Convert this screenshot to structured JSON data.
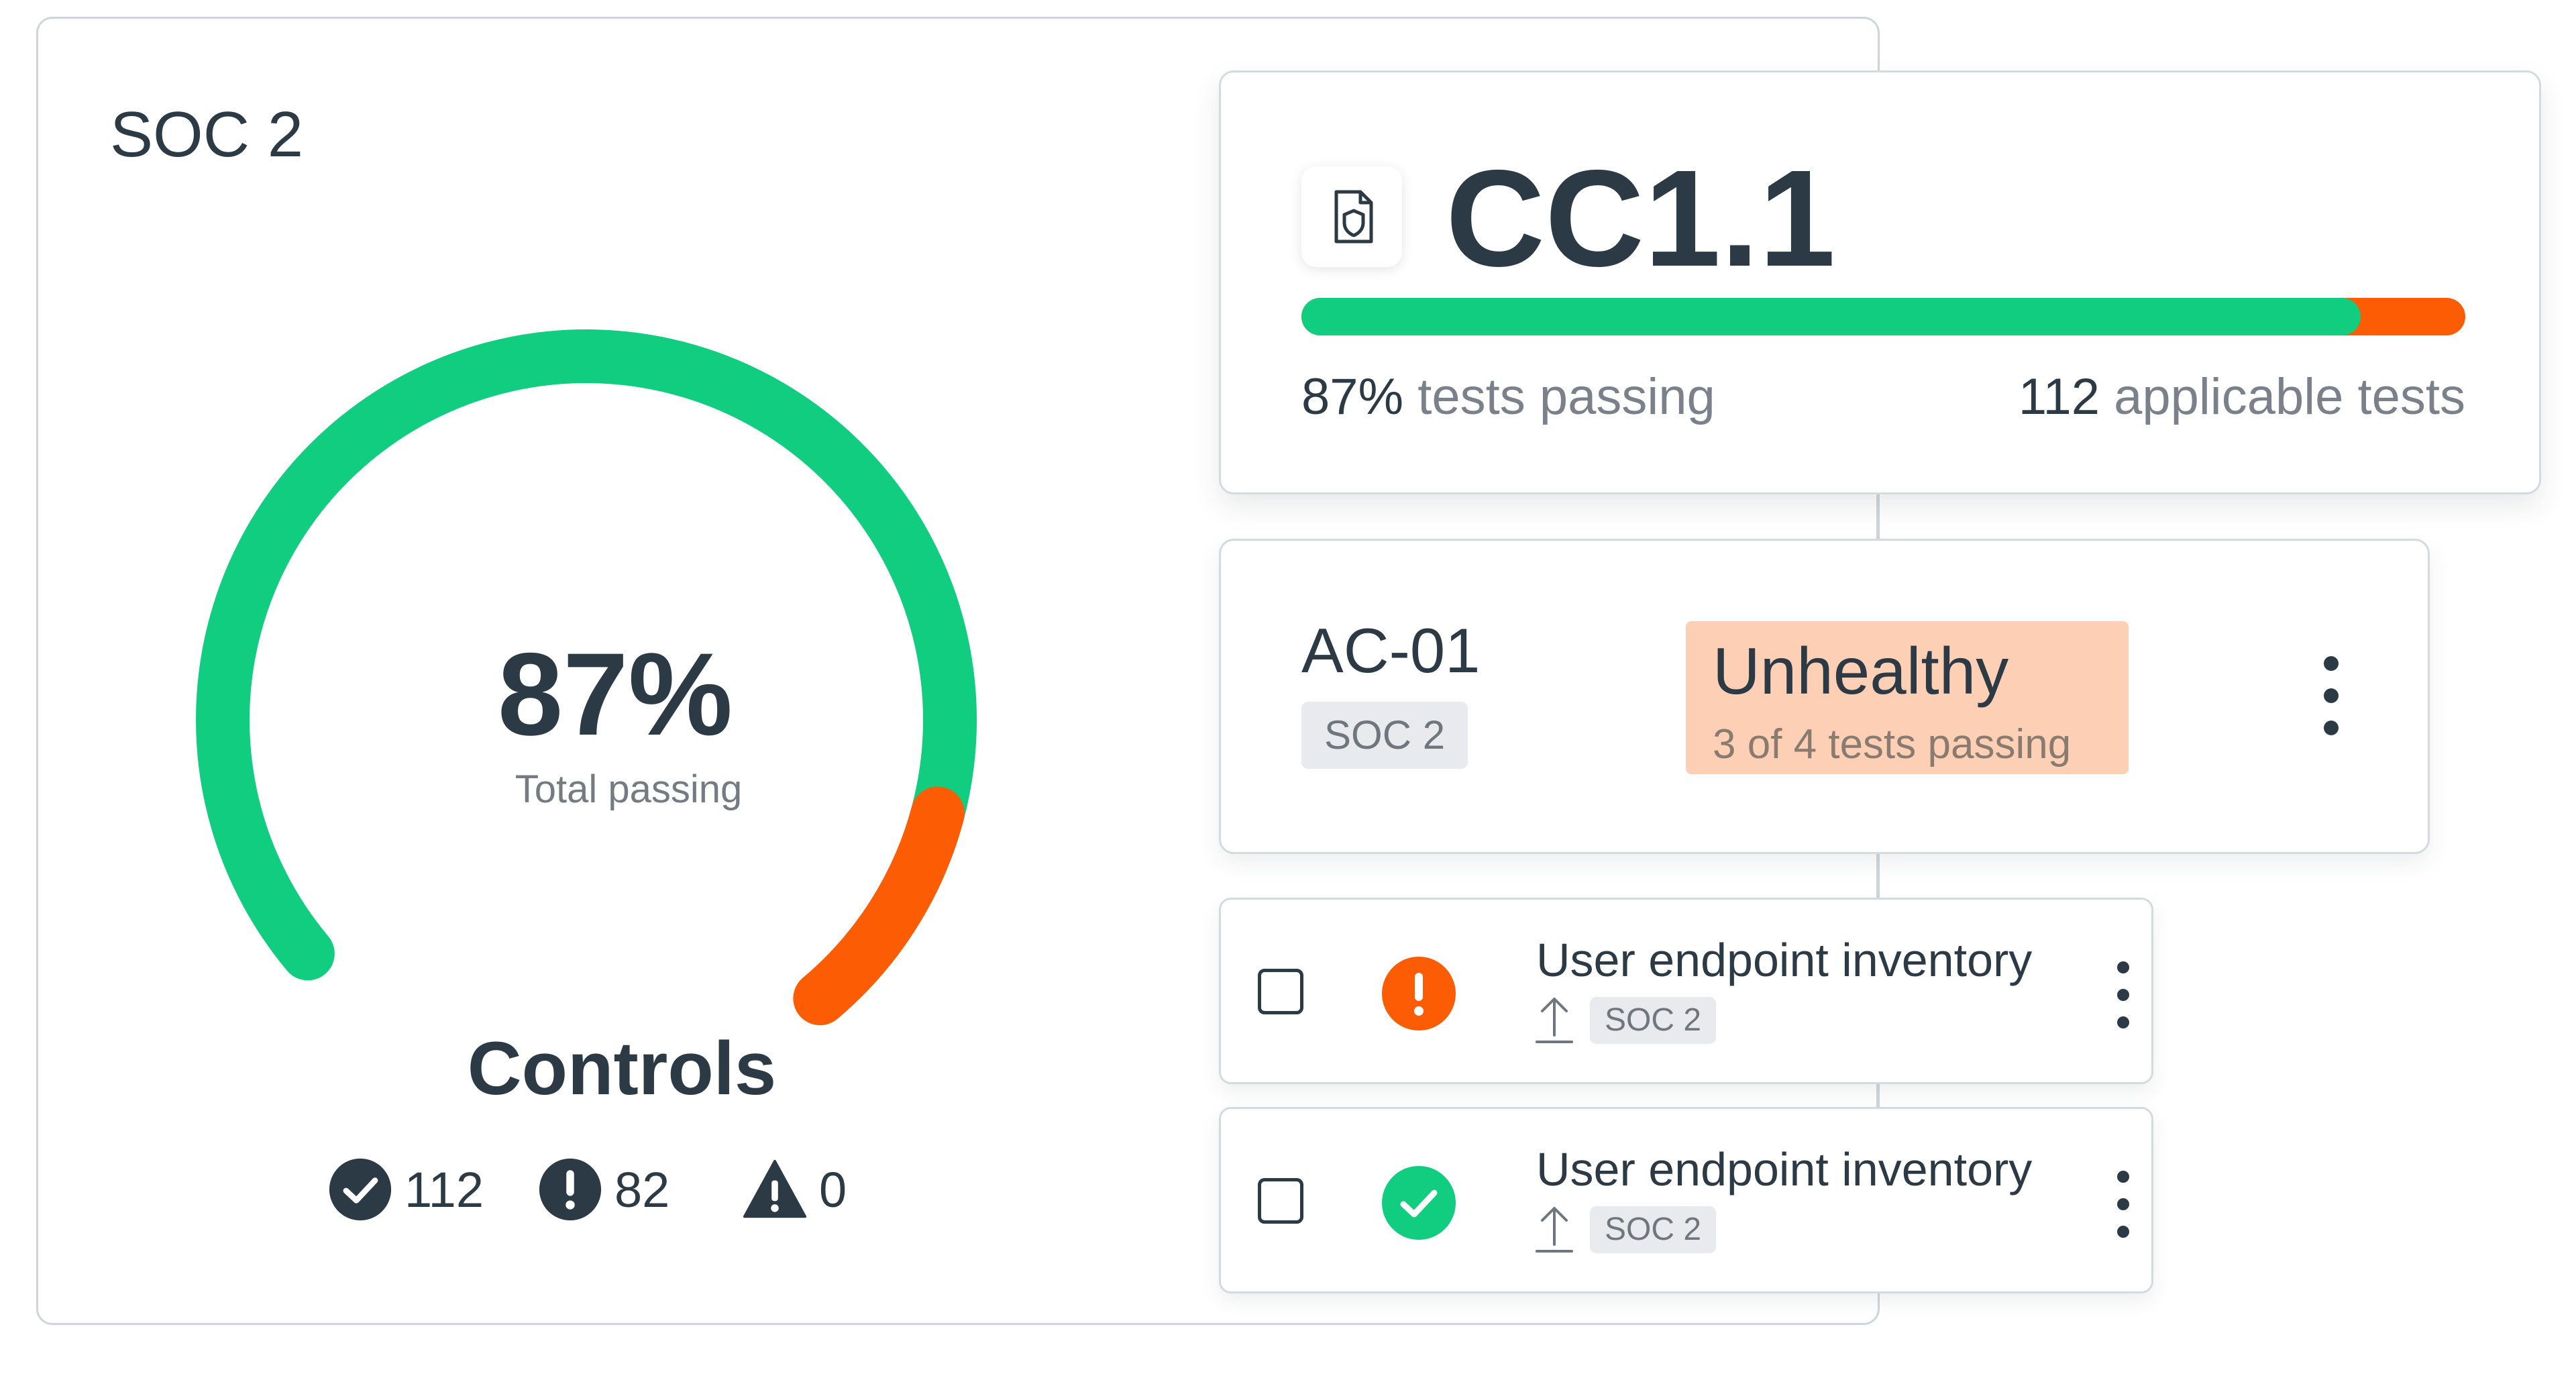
{
  "soc": {
    "title": "SOC 2",
    "gauge": {
      "percent_label": "87%",
      "percent_value": 87,
      "subtitle": "Total passing",
      "colors": {
        "pass": "#10cd7f",
        "fail": "#fc5c03"
      }
    },
    "controls": {
      "title": "Controls",
      "stats": [
        {
          "icon": "check-circle-icon",
          "value": "112"
        },
        {
          "icon": "exclamation-circle-icon",
          "value": "82"
        },
        {
          "icon": "warning-triangle-icon",
          "value": "0"
        }
      ]
    }
  },
  "control_card": {
    "icon": "document-shield-icon",
    "title": "CC1.1",
    "progress_fraction": 0.91,
    "passing_value": "87%",
    "passing_label": " tests passing",
    "applicable_value": "112",
    "applicable_label": " applicable tests"
  },
  "ac_card": {
    "title": "AC-01",
    "framework_tag": "SOC 2",
    "status_title": "Unhealthy",
    "status_detail": "3 of 4 tests passing",
    "status_color": "#fdd0b6"
  },
  "test_items": [
    {
      "title": "User endpoint inventory",
      "tag": "SOC 2",
      "status": "failing",
      "status_icon": "exclamation-circle-icon",
      "status_color": "#fc5c03"
    },
    {
      "title": "User endpoint inventory",
      "tag": "SOC 2",
      "status": "passing",
      "status_icon": "check-circle-icon",
      "status_color": "#10cd7f"
    }
  ]
}
